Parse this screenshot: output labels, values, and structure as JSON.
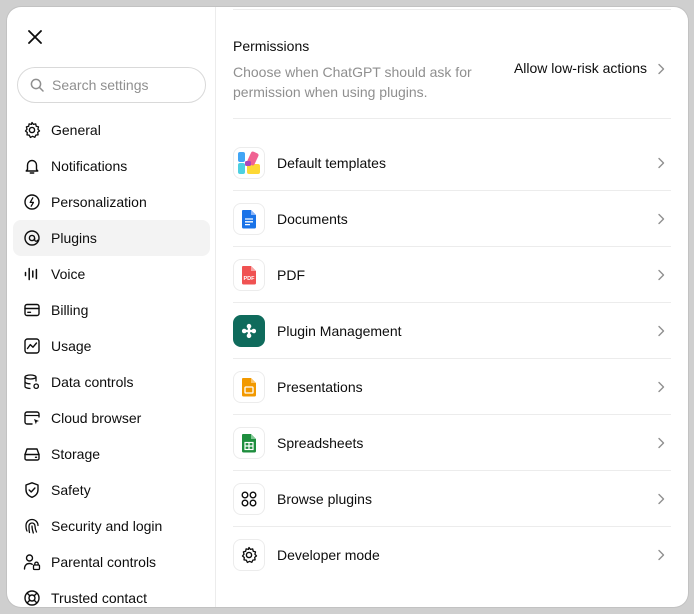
{
  "sidebar": {
    "search_placeholder": "Search settings",
    "items": [
      {
        "label": "General",
        "icon": "gear-icon"
      },
      {
        "label": "Notifications",
        "icon": "bell-icon"
      },
      {
        "label": "Personalization",
        "icon": "personalization-icon"
      },
      {
        "label": "Plugins",
        "icon": "plugins-icon",
        "active": true
      },
      {
        "label": "Voice",
        "icon": "voice-waveform-icon"
      },
      {
        "label": "Billing",
        "icon": "credit-card-icon"
      },
      {
        "label": "Usage",
        "icon": "usage-chart-icon"
      },
      {
        "label": "Data controls",
        "icon": "database-gear-icon"
      },
      {
        "label": "Cloud browser",
        "icon": "cloud-browser-icon"
      },
      {
        "label": "Storage",
        "icon": "storage-drive-icon"
      },
      {
        "label": "Safety",
        "icon": "shield-check-icon"
      },
      {
        "label": "Security and login",
        "icon": "fingerprint-icon"
      },
      {
        "label": "Parental controls",
        "icon": "parental-lock-icon"
      },
      {
        "label": "Trusted contact",
        "icon": "lifebuoy-icon"
      }
    ]
  },
  "permissions": {
    "title": "Permissions",
    "description": "Choose when ChatGPT should ask for permission when using plugins.",
    "value": "Allow low-risk actions"
  },
  "plugins": [
    {
      "label": "Default templates",
      "icon": "default-templates-icon"
    },
    {
      "label": "Documents",
      "icon": "documents-icon"
    },
    {
      "label": "PDF",
      "icon": "pdf-icon",
      "icon_text": "PDF"
    },
    {
      "label": "Plugin Management",
      "icon": "plugin-management-icon"
    },
    {
      "label": "Presentations",
      "icon": "presentations-icon"
    },
    {
      "label": "Spreadsheets",
      "icon": "spreadsheets-icon"
    },
    {
      "label": "Browse plugins",
      "icon": "browse-plugins-icon"
    },
    {
      "label": "Developer mode",
      "icon": "developer-mode-gear-icon"
    }
  ],
  "colors": {
    "accent_green": "#0f6b5c",
    "pdf_red": "#f05252",
    "docs_blue": "#1a73e8",
    "sheets_green": "#1e8e3e",
    "slides_orange": "#f29900"
  }
}
